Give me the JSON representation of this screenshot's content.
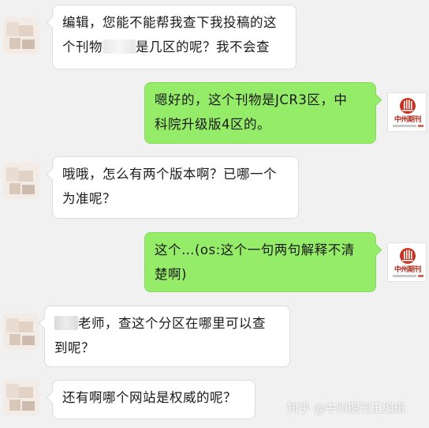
{
  "messages": [
    {
      "side": "in",
      "lines": [
        [
          "编辑，您能不能帮我查下我投稿的这"
        ],
        [
          "个刊物",
          "[redacted]",
          "是几区的呢？我不会查"
        ]
      ]
    },
    {
      "side": "out",
      "lines": [
        [
          "嗯好的，这个刊物是JCR3区，中"
        ],
        [
          "科院升级版4区的。"
        ]
      ]
    },
    {
      "side": "in",
      "lines": [
        [
          "哦哦，怎么有两个版本啊？已哪一个"
        ],
        [
          "为准呢？"
        ]
      ]
    },
    {
      "side": "out",
      "lines": [
        [
          "这个…(os:这个一句两句解释不清"
        ],
        [
          "楚啊)"
        ]
      ]
    },
    {
      "side": "in",
      "lines": [
        [
          "[redacted]",
          "老师，查这个分区在哪里可以查"
        ],
        [
          "到呢？"
        ]
      ]
    },
    {
      "side": "in",
      "lines": [
        [
          "还有啊哪个网站是权威的呢？"
        ]
      ]
    }
  ],
  "contact_logo": {
    "name": "中州期刊"
  },
  "watermark": {
    "text": "知乎 @中州期刊王编辑"
  },
  "colors": {
    "background": "#f1f1f1",
    "outgoing": "#95ec69",
    "incoming": "#ffffff",
    "logo_red": "#b22b1a"
  }
}
